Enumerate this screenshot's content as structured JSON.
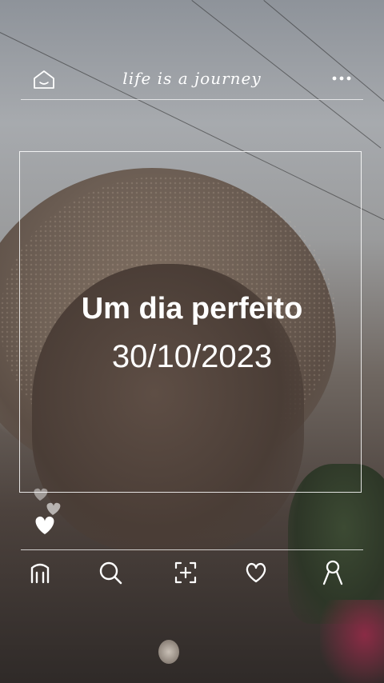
{
  "header": {
    "tagline": "life is a journey",
    "home_icon": "home-icon",
    "menu_icon": "more-icon"
  },
  "post": {
    "title": "Um dia perfeito",
    "date": "30/10/2023"
  },
  "reactions": {
    "icon": "hearts-icon"
  },
  "nav": {
    "items": [
      {
        "icon": "home-icon"
      },
      {
        "icon": "search-icon"
      },
      {
        "icon": "add-post-icon"
      },
      {
        "icon": "heart-icon"
      },
      {
        "icon": "profile-icon"
      }
    ]
  },
  "colors": {
    "overlay_text": "#ffffff",
    "frame_border": "#ffffff"
  }
}
